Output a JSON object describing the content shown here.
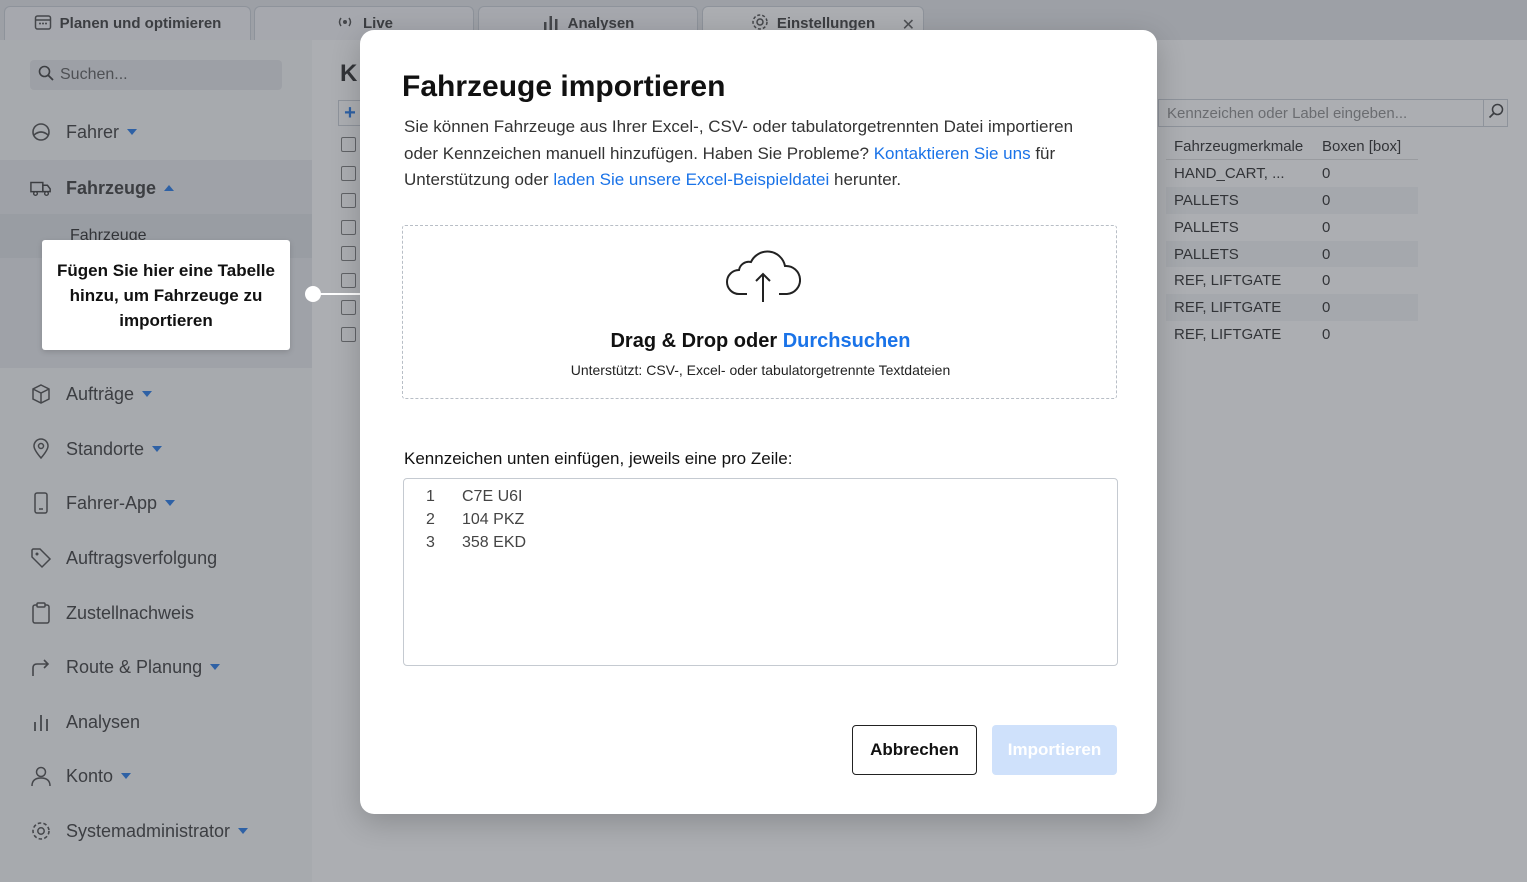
{
  "tabs": [
    {
      "label": "Planen und optimieren",
      "icon": "calendar-icon"
    },
    {
      "label": "Live",
      "icon": "broadcast-icon"
    },
    {
      "label": "Analysen",
      "icon": "bar-chart-icon"
    },
    {
      "label": "Einstellungen",
      "icon": "gear-icon",
      "close": "✕"
    }
  ],
  "sidebar": {
    "search_placeholder": "Suchen...",
    "items": [
      {
        "label": "Fahrer",
        "icon": "steering-wheel-icon"
      },
      {
        "label": "Fahrzeuge",
        "icon": "truck-icon"
      },
      {
        "label": "Aufträge",
        "icon": "package-icon"
      },
      {
        "label": "Standorte",
        "icon": "location-pin-icon"
      },
      {
        "label": "Fahrer-App",
        "icon": "phone-icon"
      },
      {
        "label": "Auftragsverfolgung",
        "icon": "tag-icon"
      },
      {
        "label": "Zustellnachweis",
        "icon": "clipboard-icon"
      },
      {
        "label": "Route & Planung",
        "icon": "route-arrow-icon"
      },
      {
        "label": "Analysen",
        "icon": "bar-chart-icon"
      },
      {
        "label": "Konto",
        "icon": "user-icon"
      },
      {
        "label": "Systemadministrator",
        "icon": "gear-icon"
      }
    ],
    "sub_item": "Fahrzeuge"
  },
  "tooltip": {
    "text": "Fügen Sie hier eine Tabelle hinzu, um Fahrzeuge zu importieren"
  },
  "main": {
    "title_partial": "K",
    "add_symbol": "+",
    "search_placeholder": "Kennzeichen oder Label eingeben...",
    "table": {
      "headers": [
        "Fahrzeugmerkmale",
        "Boxen [box]"
      ],
      "rows": [
        [
          "HAND_CART, ...",
          "0"
        ],
        [
          "PALLETS",
          "0"
        ],
        [
          "PALLETS",
          "0"
        ],
        [
          "PALLETS",
          "0"
        ],
        [
          "REF, LIFTGATE",
          "0"
        ],
        [
          "REF, LIFTGATE",
          "0"
        ],
        [
          "REF, LIFTGATE",
          "0"
        ]
      ]
    }
  },
  "modal": {
    "title": "Fahrzeuge importieren",
    "desc_part1": "Sie können Fahrzeuge aus Ihrer Excel-, CSV- oder tabulatorgetrennten Datei importieren oder Kennzeichen manuell hinzufügen. Haben Sie Probleme? ",
    "desc_link1": "Kontaktieren Sie uns",
    "desc_part2": " für Unterstützung oder ",
    "desc_link2": "laden Sie unsere Excel-Beispieldatei",
    "desc_part3": " herunter.",
    "dropzone": {
      "main_text": "Drag & Drop oder ",
      "browse_link": "Durchsuchen",
      "supported": "Unterstützt: CSV-, Excel- oder  tabulatorgetrennte Textdateien"
    },
    "paste_label": "Kennzeichen unten einfügen, jeweils eine pro Zeile:",
    "plates": [
      {
        "n": "1",
        "value": "C7E U6I"
      },
      {
        "n": "2",
        "value": "104 PKZ"
      },
      {
        "n": "3",
        "value": "358 EKD"
      }
    ],
    "cancel_label": "Abbrechen",
    "import_label": "Importieren"
  },
  "colors": {
    "accent": "#1a73e8",
    "import_disabled": "#cfe1fb"
  }
}
